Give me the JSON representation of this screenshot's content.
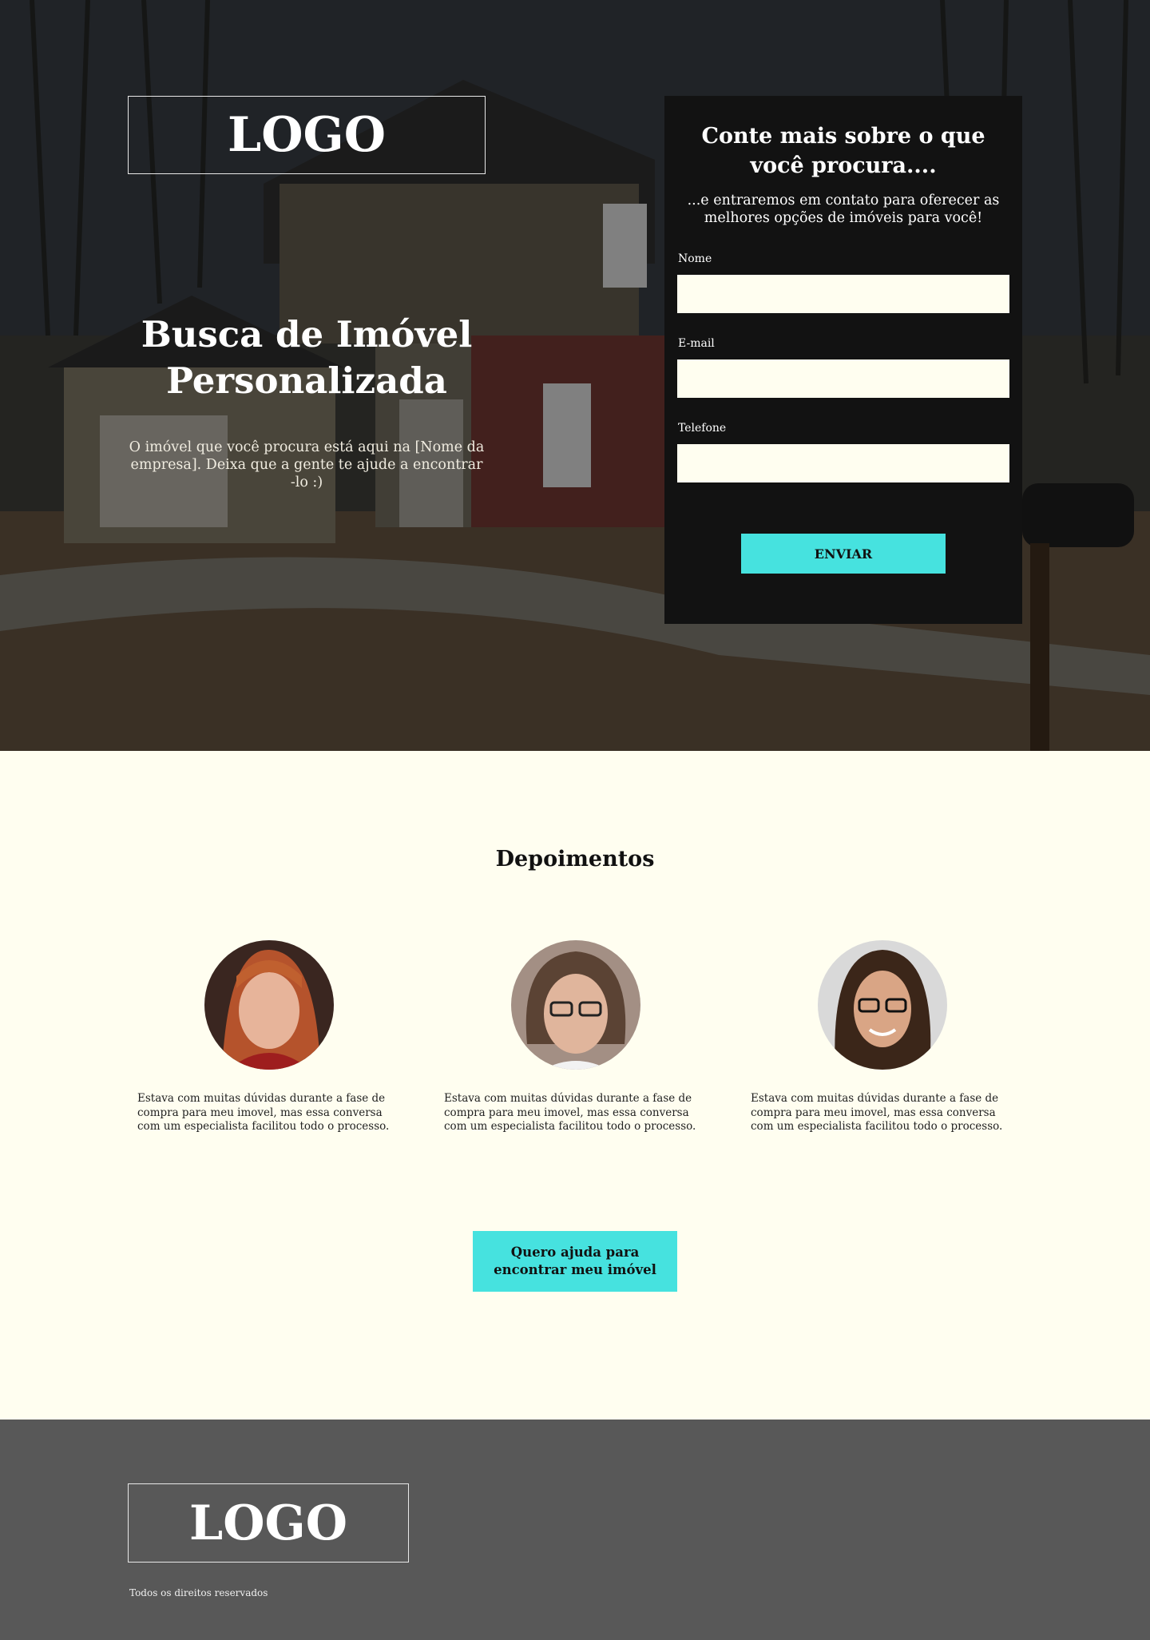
{
  "hero": {
    "logo": "LOGO",
    "title": "Busca de Imóvel Personalizada",
    "subtitle": "O imóvel que você procura está aqui na [Nome da empresa]. Deixa que a gente te ajude a encontrar -lo :)"
  },
  "form": {
    "title": "Conte mais sobre o que você procura....",
    "subtitle": "...e entraremos em contato para oferecer as melhores opções de imóveis para você!",
    "fields": [
      {
        "label": "Nome",
        "value": ""
      },
      {
        "label": "E-mail",
        "value": ""
      },
      {
        "label": "Telefone",
        "value": ""
      }
    ],
    "submit_label": "ENVIAR"
  },
  "testimonials": {
    "title": "Depoimentos",
    "items": [
      {
        "text": "Estava com muitas dúvidas durante a fase de compra para meu imovel, mas essa conversa com um especialista facilitou todo o processo."
      },
      {
        "text": "Estava com muitas dúvidas durante a fase de compra para meu imovel, mas essa conversa com um especialista facilitou todo o processo."
      },
      {
        "text": "Estava com muitas dúvidas durante a fase de compra para meu imovel, mas essa conversa com um especialista facilitou todo o processo."
      }
    ],
    "cta_label": "Quero ajuda para encontrar meu imóvel"
  },
  "footer": {
    "logo": "LOGO",
    "copyright": "Todos os direitos reservados"
  },
  "colors": {
    "accent": "#46e2df",
    "form_bg": "#121212",
    "page_bg": "#fffef0",
    "footer_bg": "#585858"
  }
}
